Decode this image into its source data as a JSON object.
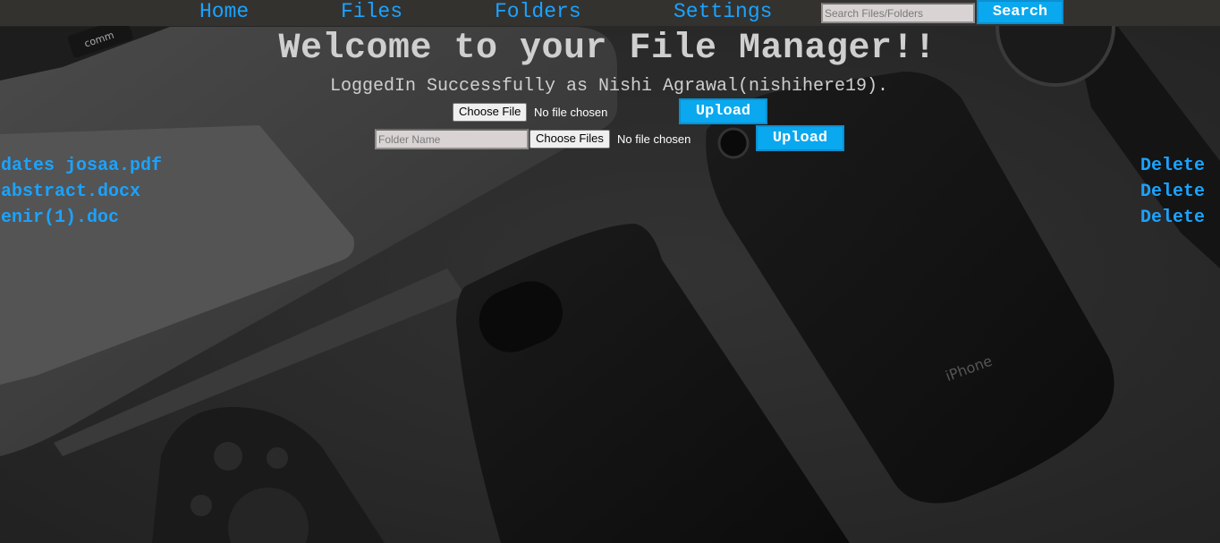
{
  "nav": {
    "home": "Home",
    "files": "Files",
    "folders": "Folders",
    "settings": "Settings",
    "search_placeholder": "Search Files/Folders",
    "search_button": "Search"
  },
  "header": {
    "welcome": "Welcome to your File Manager!!",
    "logged_in": "LoggedIn Successfully as Nishi Agrawal(nishihere19)."
  },
  "upload_file": {
    "choose_label": "Choose File",
    "status": "No file chosen",
    "upload_button": "Upload"
  },
  "upload_folder": {
    "folder_placeholder": "Folder Name",
    "choose_label": "Choose Files",
    "status": "No file chosen",
    "upload_button": "Upload"
  },
  "files": [
    {
      "name": "dates josaa.pdf",
      "action": "Delete"
    },
    {
      "name": "abstract.docx",
      "action": "Delete"
    },
    {
      "name": "enir(1).doc",
      "action": "Delete"
    }
  ],
  "colors": {
    "link": "#1aa3ff",
    "button": "#0aa8ee",
    "navbar": "#34322f",
    "text": "#cfcfcf"
  },
  "background_photo_text": {
    "laptop_key": "comm",
    "phone_brand": "iPhone"
  }
}
